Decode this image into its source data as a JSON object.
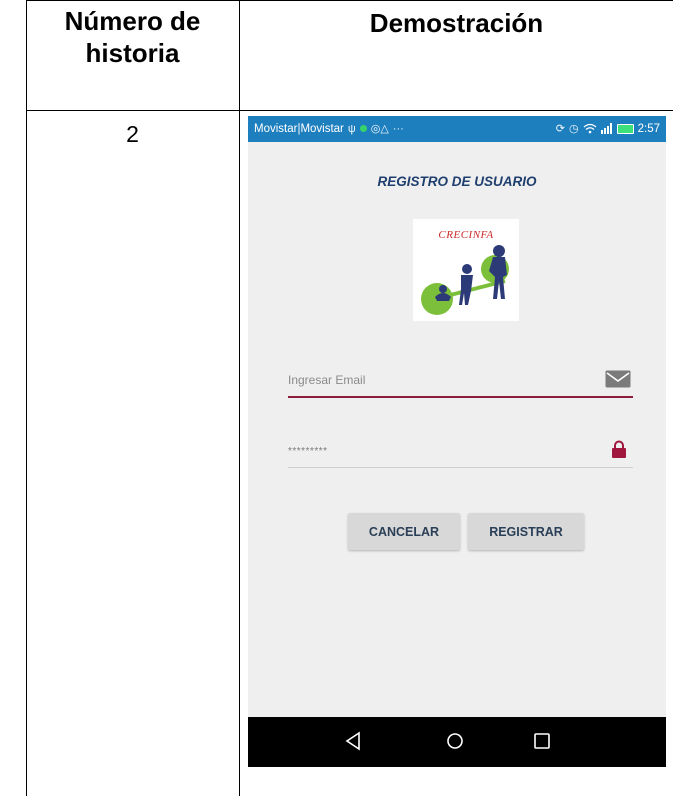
{
  "table": {
    "header_story": "Número de historia",
    "header_demo": "Demostración",
    "story_number": "2"
  },
  "status_bar": {
    "carrier": "Movistar|Movistar",
    "time": "2:57",
    "icons": [
      "usb-icon",
      "whatsapp-dot-icon",
      "notification-icons",
      "overflow-dots-icon",
      "sync-icon",
      "alarm-icon",
      "wifi-icon",
      "signal-icon",
      "battery-icon"
    ]
  },
  "screen": {
    "title": "REGISTRO DE USUARIO",
    "logo_text": "CRECINFA",
    "email": {
      "placeholder": "Ingresar Email",
      "icon": "envelope-icon"
    },
    "password": {
      "value": "*********",
      "icon": "lock-icon"
    },
    "buttons": {
      "cancel": "CANCELAR",
      "register": "REGISTRAR"
    }
  },
  "nav_bar": {
    "icons": [
      "back-icon",
      "home-icon",
      "recents-icon"
    ]
  },
  "colors": {
    "status_bar": "#1e7fbf",
    "title_text": "#1f3f6f",
    "email_underline": "#8c1d3c",
    "lock_icon": "#a0163d",
    "button_bg": "#d8d8d8",
    "screen_bg": "#efefef"
  }
}
